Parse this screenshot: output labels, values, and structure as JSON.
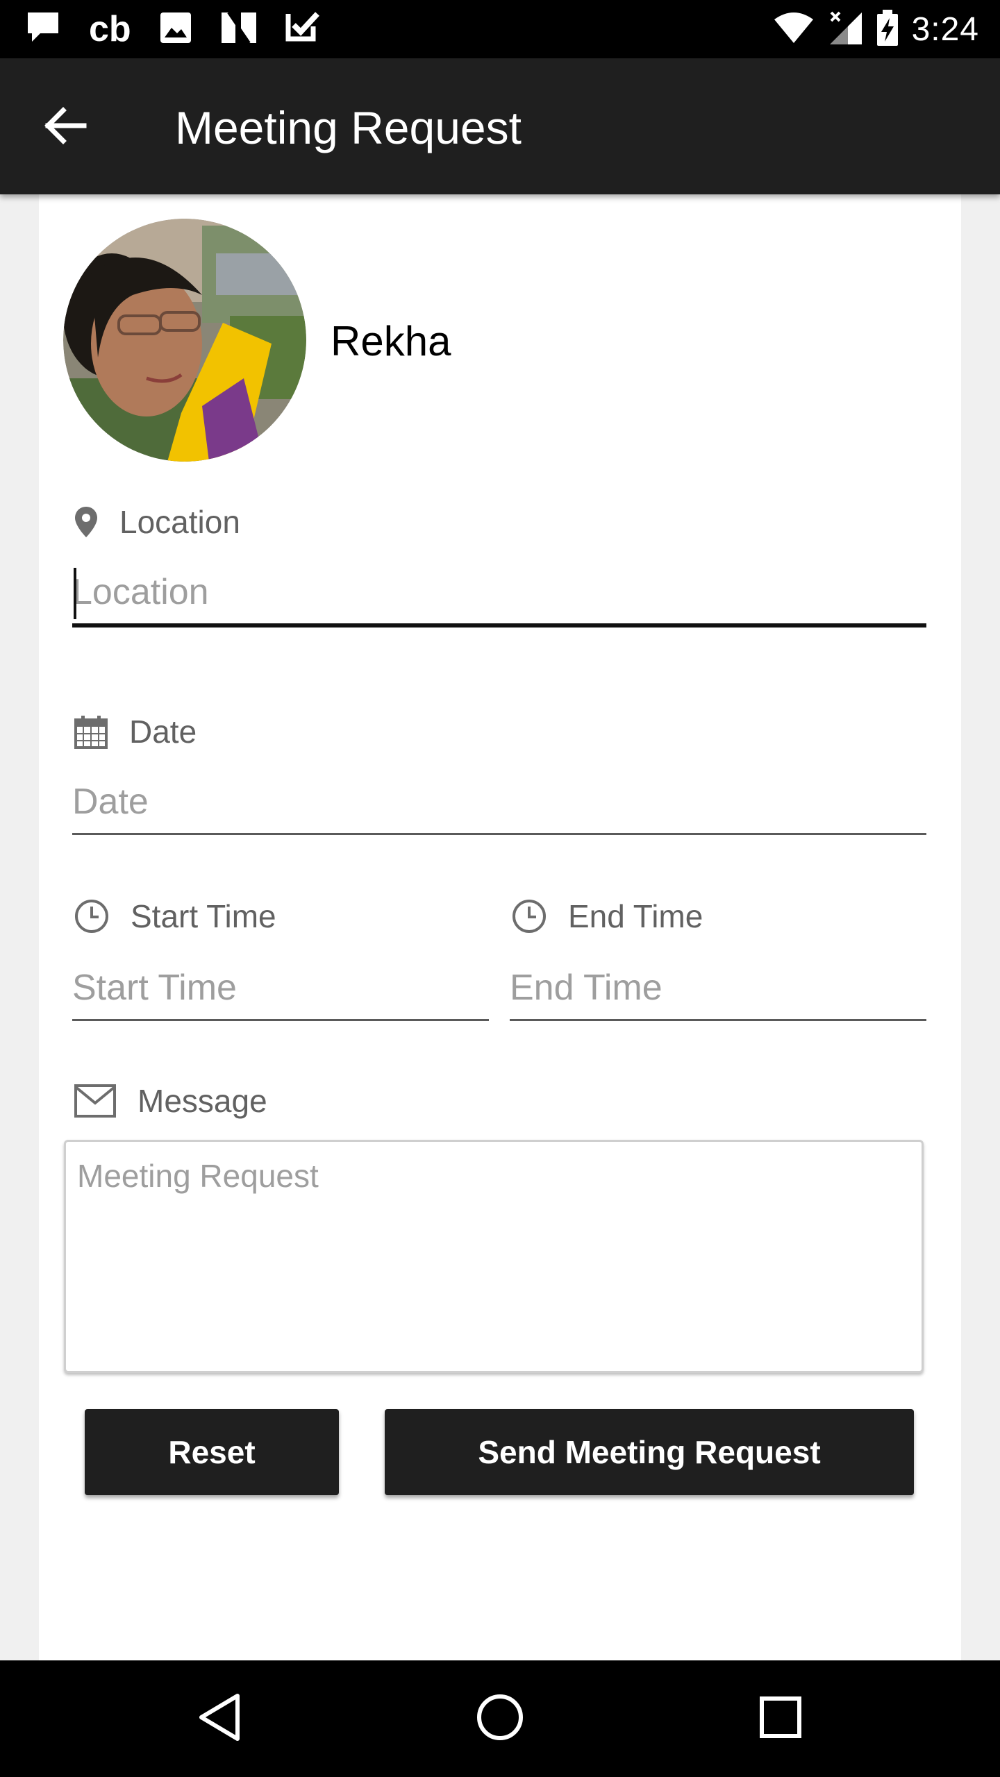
{
  "status_bar": {
    "time": "3:24",
    "left_icons": [
      "notification-icon",
      "cb-app-icon",
      "image-icon",
      "n-app-icon",
      "checkbox-app-icon"
    ],
    "cb_text": "cb",
    "right_icons": [
      "wifi-icon",
      "signal-icon",
      "battery-charging-icon"
    ]
  },
  "app_bar": {
    "title": "Meeting Request",
    "back_icon": "arrow-back-icon"
  },
  "profile": {
    "name": "Rekha"
  },
  "form": {
    "location": {
      "label": "Location",
      "placeholder": "Location",
      "value": "",
      "icon": "location-pin-icon"
    },
    "date": {
      "label": "Date",
      "placeholder": "Date",
      "value": "",
      "icon": "calendar-icon"
    },
    "start_time": {
      "label": "Start Time",
      "placeholder": "Start Time",
      "value": "",
      "icon": "clock-icon"
    },
    "end_time": {
      "label": "End Time",
      "placeholder": "End Time",
      "value": "",
      "icon": "clock-icon"
    },
    "message": {
      "label": "Message",
      "placeholder": "Meeting Request",
      "value": "",
      "icon": "envelope-icon"
    }
  },
  "buttons": {
    "reset": "Reset",
    "send": "Send Meeting Request"
  },
  "colors": {
    "app_bar": "#1f1f1f",
    "button": "#1f1f1f",
    "background": "#f0f0f0",
    "label_text": "#616161",
    "placeholder": "#9e9e9e"
  },
  "nav_bar": {
    "icons": [
      "nav-back-icon",
      "nav-home-icon",
      "nav-recents-icon"
    ]
  }
}
